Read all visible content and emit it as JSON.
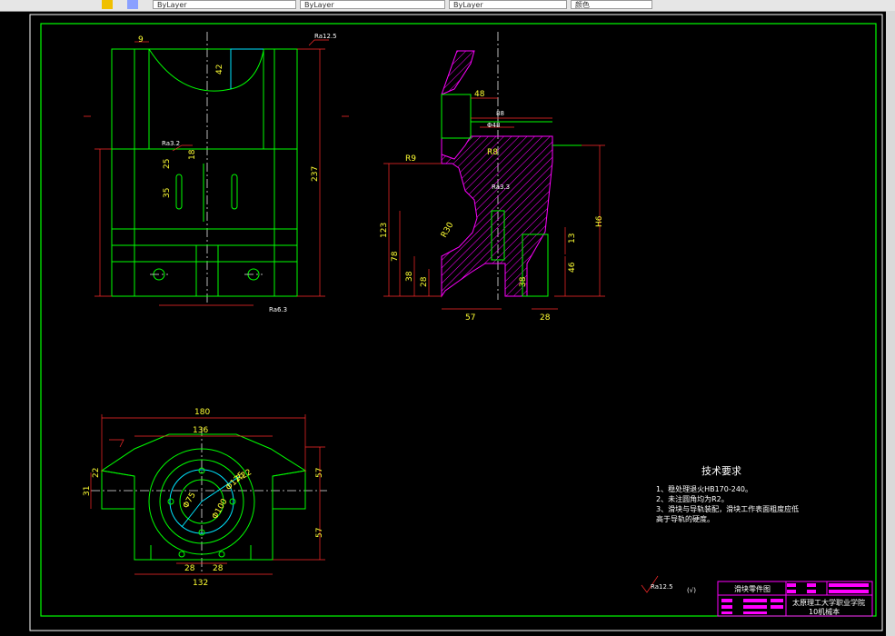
{
  "toolbar": {
    "field1": "ByLayer",
    "field2": "ByLayer",
    "field3": "ByLayer",
    "field4": "颜色"
  },
  "dimensions": {
    "front": {
      "top_left": "9",
      "top_depth": "42",
      "rough_top": "Ra12.5",
      "slot1": "25",
      "slot2": "18",
      "slot3": "35",
      "height": "237",
      "rough_mid": "Ra3.2",
      "rough_bottom": "Ra6.3"
    },
    "side": {
      "d48": "48",
      "d_phi48": "Φ48",
      "d6": "88",
      "r9": "R9",
      "r8": "R8",
      "r30": "R30",
      "h123": "123",
      "h78": "78",
      "h38": "38",
      "h28": "28",
      "h38b": "38",
      "w57": "57",
      "w28": "28",
      "h46": "46",
      "h13": "13",
      "hh": "H6",
      "rough": "Ra3.3"
    },
    "top": {
      "w180": "180",
      "w136": "136",
      "w132": "132",
      "d28a": "28",
      "d28b": "28",
      "h57a": "57",
      "h57b": "57",
      "d31": "31",
      "d22": "22",
      "r22": "R22",
      "phi75": "Φ75",
      "phi100": "Φ100",
      "phi125": "Φ125"
    }
  },
  "notes": {
    "title": "技术要求",
    "line1": "1、稳处理退火HB170-240。",
    "line2": "2、未注圆角均为R2。",
    "line3": "3、滑块与导轨装配，滑块工作表面粗度应低",
    "line4": "高于导轨的硬度。"
  },
  "roughness_symbol": "Ra12.5",
  "roughness_paren": "(√)",
  "title_block": {
    "part_name": "滑块零件图",
    "school": "太原理工大学职业学院",
    "class": "10机械本"
  },
  "colors": {
    "frame": "#00ff00",
    "dimension": "#ff2a2a",
    "hatch": "#ff00ff",
    "text": "#ffffff"
  }
}
